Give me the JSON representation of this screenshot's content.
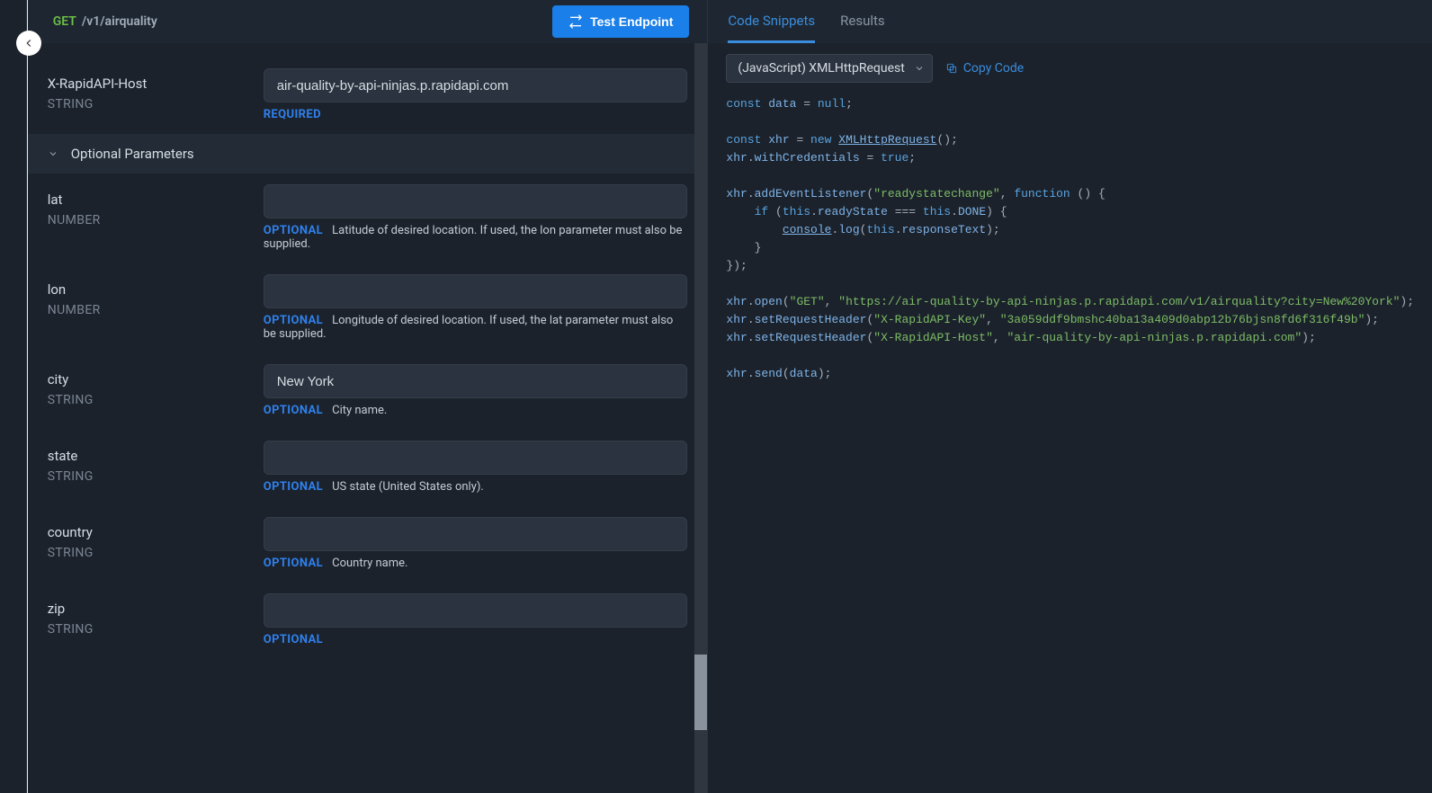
{
  "header": {
    "method": "GET",
    "path": "/v1/airquality",
    "test_button": "Test Endpoint"
  },
  "params": {
    "host": {
      "name": "X-RapidAPI-Host",
      "type": "STRING",
      "value": "air-quality-by-api-ninjas.p.rapidapi.com",
      "badge": "REQUIRED"
    },
    "section_title": "Optional Parameters",
    "optional": [
      {
        "name": "lat",
        "type": "NUMBER",
        "value": "",
        "badge": "OPTIONAL",
        "desc": "Latitude of desired location. If used, the lon parameter must also be supplied."
      },
      {
        "name": "lon",
        "type": "NUMBER",
        "value": "",
        "badge": "OPTIONAL",
        "desc": "Longitude of desired location. If used, the lat parameter must also be supplied."
      },
      {
        "name": "city",
        "type": "STRING",
        "value": "New York",
        "badge": "OPTIONAL",
        "desc": "City name."
      },
      {
        "name": "state",
        "type": "STRING",
        "value": "",
        "badge": "OPTIONAL",
        "desc": "US state (United States only)."
      },
      {
        "name": "country",
        "type": "STRING",
        "value": "",
        "badge": "OPTIONAL",
        "desc": "Country name."
      },
      {
        "name": "zip",
        "type": "STRING",
        "value": "",
        "badge": "OPTIONAL",
        "desc": ""
      }
    ]
  },
  "right": {
    "tabs": {
      "snippets": "Code Snippets",
      "results": "Results"
    },
    "lang_select": "(JavaScript) XMLHttpRequest",
    "copy_label": "Copy Code"
  },
  "code": {
    "l1_const": "const",
    "l1_data": "data",
    "l1_eq": " = ",
    "l1_null": "null",
    "l1_semi": ";",
    "l3_const": "const",
    "l3_xhr": "xhr",
    "l3_eq": " = ",
    "l3_new": "new",
    "l3_class": "XMLHttpRequest",
    "l3_paren": "();",
    "l4_xhr": "xhr",
    "l4_dot": ".",
    "l4_prop": "withCredentials",
    "l4_eq": " = ",
    "l4_true": "true",
    "l4_semi": ";",
    "l6_xhr": "xhr",
    "l6_dot": ".",
    "l6_fn": "addEventListener",
    "l6_open": "(",
    "l6_str": "\"readystatechange\"",
    "l6_comma": ", ",
    "l6_kw": "function",
    "l6_rest": " () {",
    "l7_pad": "    ",
    "l7_if": "if",
    "l7_open": " (",
    "l7_this": "this",
    "l7_dot1": ".",
    "l7_prop1": "readyState",
    "l7_eqeq": " === ",
    "l7_this2": "this",
    "l7_dot2": ".",
    "l7_done": "DONE",
    "l7_rest": ") {",
    "l8_pad": "        ",
    "l8_console": "console",
    "l8_dot": ".",
    "l8_log": "log",
    "l8_open": "(",
    "l8_this": "this",
    "l8_dot2": ".",
    "l8_rt": "responseText",
    "l8_close": ");",
    "l9": "    }",
    "l10": "});",
    "l12_xhr": "xhr",
    "l12_dot": ".",
    "l12_fn": "open",
    "l12_open": "(",
    "l12_s1": "\"GET\"",
    "l12_c": ", ",
    "l12_s2": "\"https://air-quality-by-api-ninjas.p.rapidapi.com/v1/airquality?city=New%20York\"",
    "l12_close": ");",
    "l13_xhr": "xhr",
    "l13_dot": ".",
    "l13_fn": "setRequestHeader",
    "l13_open": "(",
    "l13_s1": "\"X-RapidAPI-Key\"",
    "l13_c": ", ",
    "l13_s2": "\"3a059ddf9bmshc40ba13a409d0abp12b76bjsn8fd6f316f49b\"",
    "l13_close": ");",
    "l14_xhr": "xhr",
    "l14_dot": ".",
    "l14_fn": "setRequestHeader",
    "l14_open": "(",
    "l14_s1": "\"X-RapidAPI-Host\"",
    "l14_c": ", ",
    "l14_s2": "\"air-quality-by-api-ninjas.p.rapidapi.com\"",
    "l14_close": ");",
    "l16_xhr": "xhr",
    "l16_dot": ".",
    "l16_fn": "send",
    "l16_open": "(",
    "l16_data": "data",
    "l16_close": ");"
  }
}
